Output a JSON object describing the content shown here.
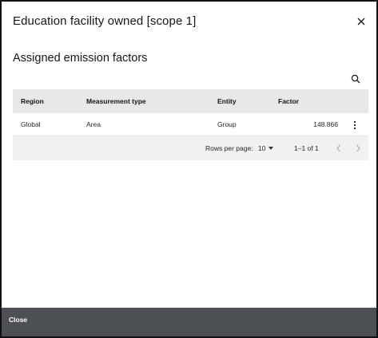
{
  "modal": {
    "title": "Education facility owned [scope 1]",
    "close_icon": "close-icon"
  },
  "section": {
    "title": "Assigned emission factors",
    "search_icon": "search-icon"
  },
  "table": {
    "headers": [
      "Region",
      "Measurement type",
      "Entity",
      "Factor"
    ],
    "rows": [
      {
        "region": "Global",
        "measurement_type": "Area",
        "entity": "Group",
        "factor": "148.866",
        "overflow_icon": "overflow-menu-icon"
      }
    ]
  },
  "pagination": {
    "rows_per_page_label": "Rows per page:",
    "rows_per_page_value": "10",
    "range": "1–1 of 1",
    "prev_icon": "chevron-left-icon",
    "next_icon": "chevron-right-icon"
  },
  "footer": {
    "close_label": "Close"
  },
  "colors": {
    "header_bg": "#e8e8ea",
    "pager_bg": "#f1f1f2",
    "footer_bg": "#4c4f54",
    "text": "#161616"
  }
}
